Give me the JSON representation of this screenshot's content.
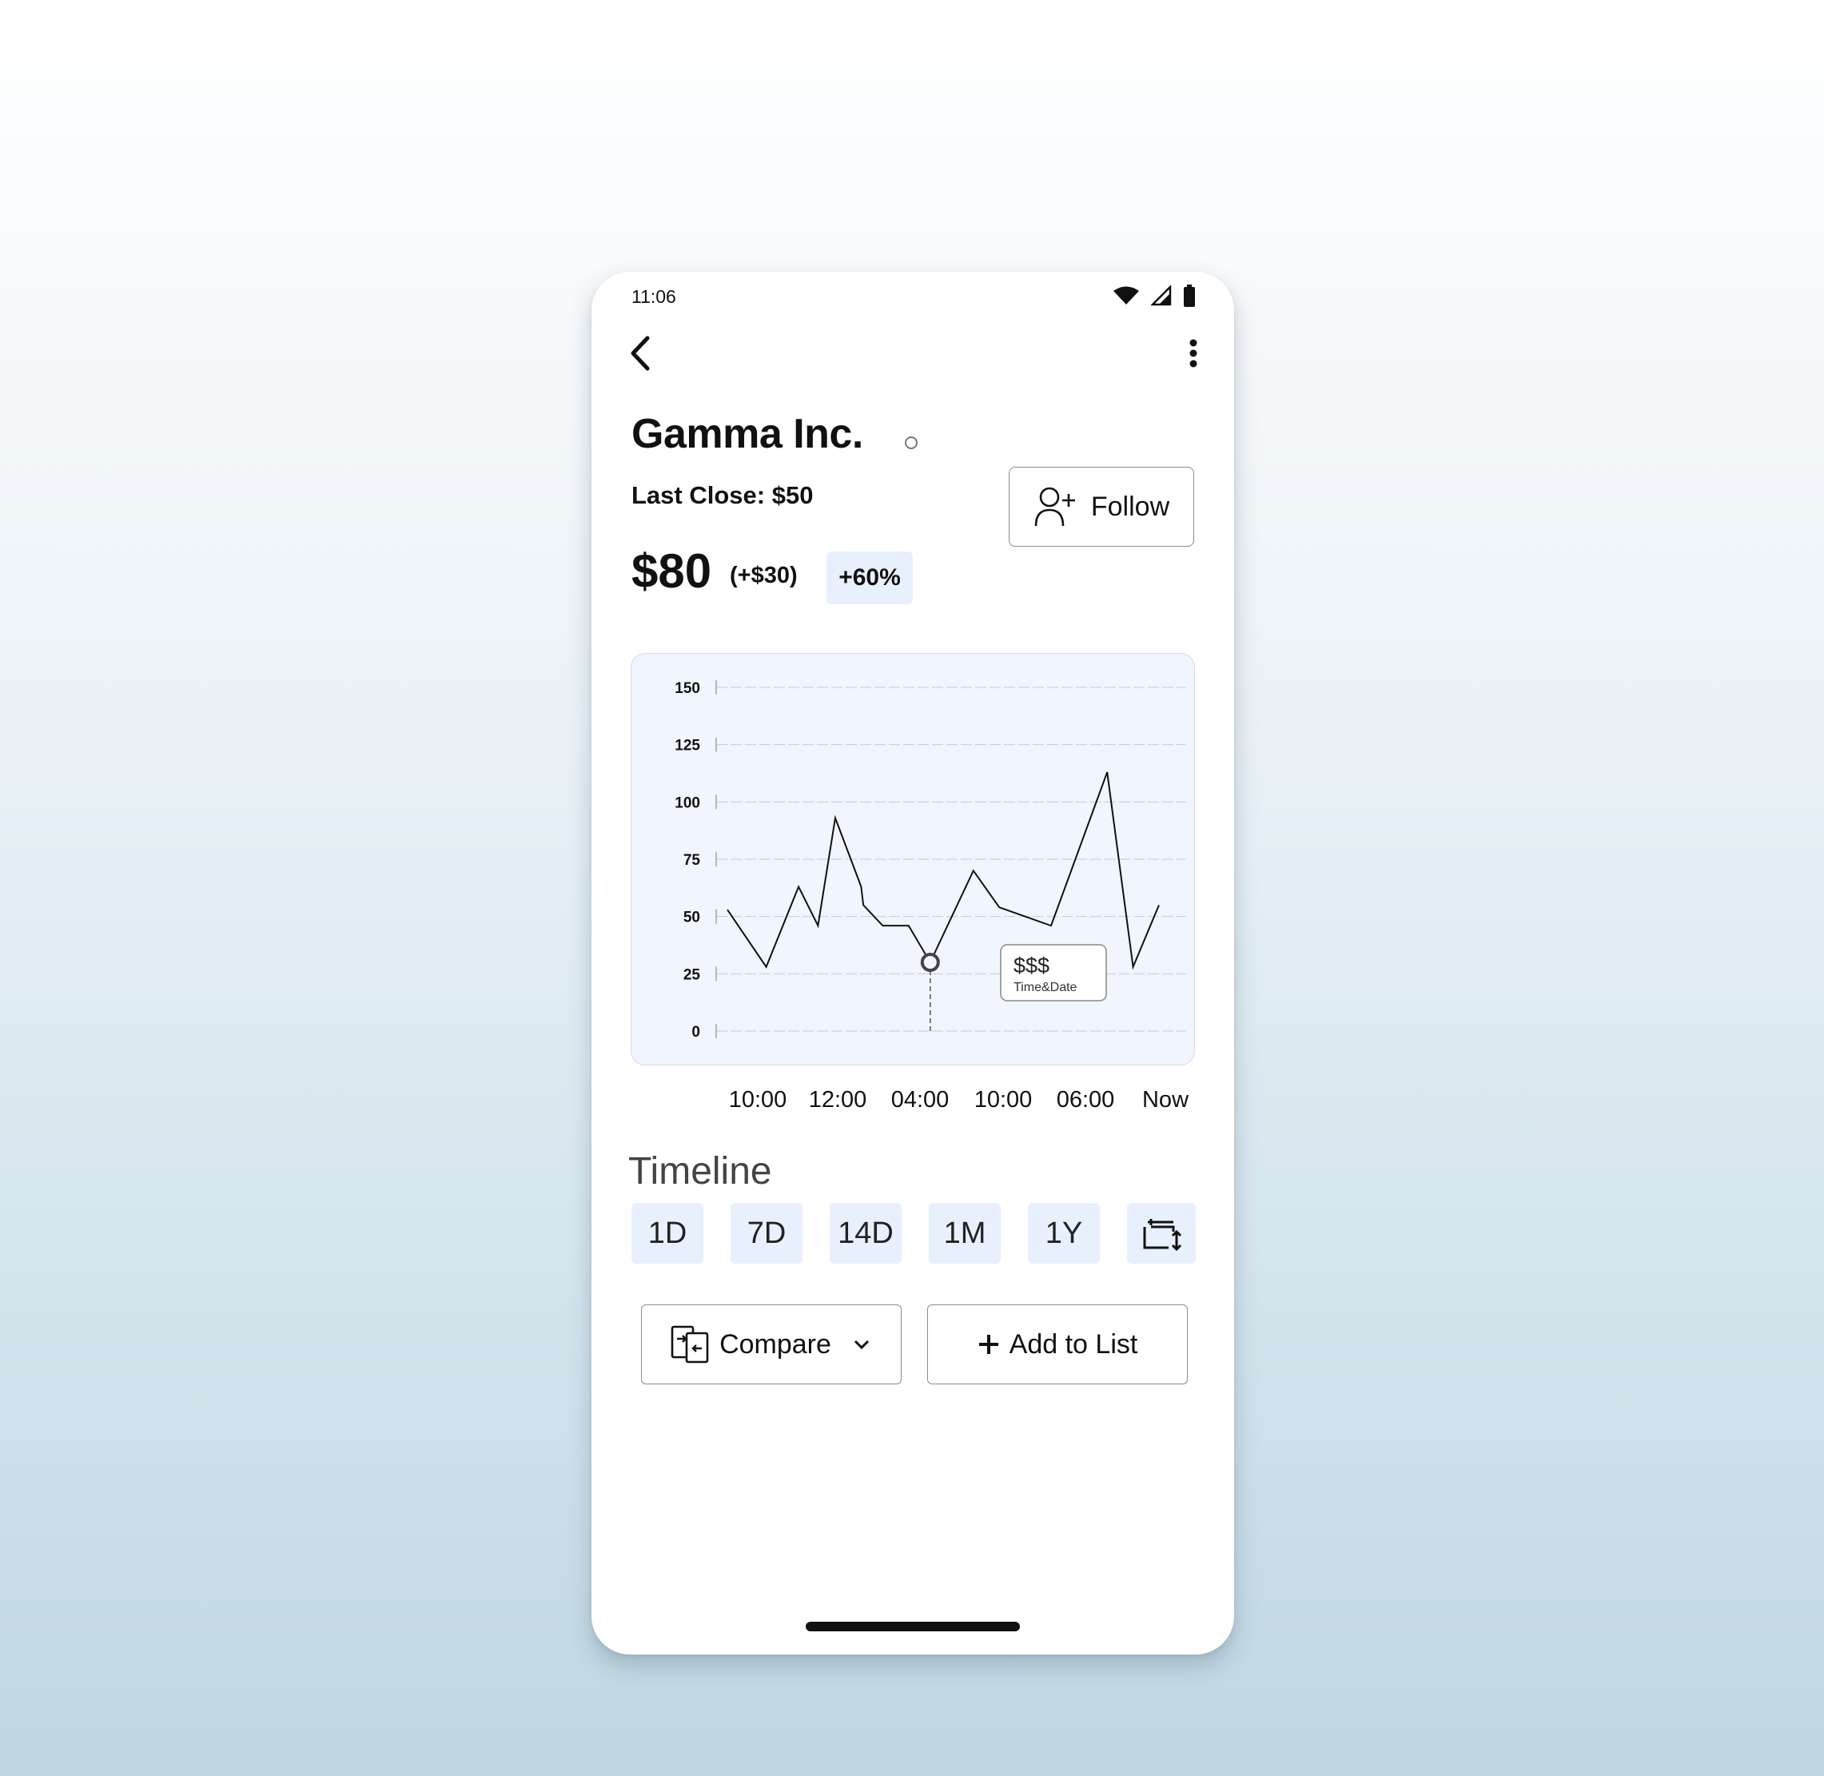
{
  "status_bar": {
    "time": "11:06",
    "icons": [
      "wifi-icon",
      "signal-icon",
      "battery-icon"
    ]
  },
  "header": {
    "back_icon": "chevron-left-icon",
    "menu_icon": "more-vertical-icon"
  },
  "stock": {
    "name": "Gamma Inc.",
    "last_close": "Last Close: $50",
    "price": "$80",
    "change": "(+$30)",
    "change_pct": "+60%"
  },
  "follow_button": {
    "label": "Follow",
    "icon": "add-user-icon"
  },
  "chart_data": {
    "type": "line",
    "y_ticks": [
      "150",
      "125",
      "100",
      "75",
      "50",
      "25",
      "0"
    ],
    "ylim": [
      0,
      150
    ],
    "grid": true,
    "x_tick_labels": [
      "10:00",
      "12:00",
      "04:00",
      "10:00",
      "06:00",
      "Now"
    ],
    "points": [
      [
        0,
        53
      ],
      [
        0.09,
        28
      ],
      [
        0.165,
        63
      ],
      [
        0.21,
        46
      ],
      [
        0.25,
        93
      ],
      [
        0.31,
        63
      ],
      [
        0.315,
        55
      ],
      [
        0.36,
        46
      ],
      [
        0.42,
        46
      ],
      [
        0.47,
        30
      ],
      [
        0.57,
        70
      ],
      [
        0.63,
        54
      ],
      [
        0.75,
        46
      ],
      [
        0.88,
        113
      ],
      [
        0.94,
        28
      ],
      [
        1.0,
        55
      ]
    ],
    "tooltip": {
      "value": "$$$",
      "label": "Time&Date"
    },
    "line_color": "#111111"
  },
  "timeline": {
    "title": "Timeline",
    "options": [
      "1D",
      "7D",
      "14D",
      "1M",
      "1Y"
    ],
    "custom_icon": "custom-range-icon"
  },
  "actions": {
    "compare_label": "Compare",
    "compare_icon": "compare-icon",
    "add_label": "Add to List",
    "add_icon": "plus-icon"
  },
  "colors": {
    "accent_bg": "#e8f0fd",
    "chart_bg": "#f0f5fe"
  }
}
